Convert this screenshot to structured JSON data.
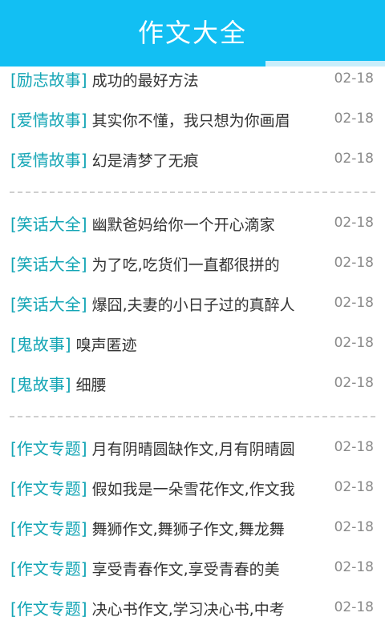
{
  "header": {
    "title": "作文大全",
    "background_color": "#12bff3",
    "progress": 0.69
  },
  "groups": [
    {
      "items": [
        {
          "category": "[励志故事]",
          "title": "成功的最好方法",
          "date": "02-18"
        },
        {
          "category": "[爱情故事]",
          "title": "其实你不懂，我只想为你画眉",
          "date": "02-18"
        },
        {
          "category": "[爱情故事]",
          "title": "幻是清梦了无痕",
          "date": "02-18"
        }
      ]
    },
    {
      "items": [
        {
          "category": "[笑话大全]",
          "title": "幽默爸妈给你一个开心滴家",
          "date": "02-18"
        },
        {
          "category": "[笑话大全]",
          "title": "为了吃,吃货们一直都很拼的",
          "date": "02-18"
        },
        {
          "category": "[笑话大全]",
          "title": "爆囧,夫妻的小日子过的真醉人",
          "date": "02-18"
        },
        {
          "category": "[鬼故事]",
          "title": "嗅声匿迹",
          "date": "02-18"
        },
        {
          "category": "[鬼故事]",
          "title": "细腰",
          "date": "02-18"
        }
      ]
    },
    {
      "items": [
        {
          "category": "[作文专题]",
          "title": "月有阴晴圆缺作文,月有阴晴圆",
          "date": "02-18"
        },
        {
          "category": "[作文专题]",
          "title": "假如我是一朵雪花作文,作文我",
          "date": "02-18"
        },
        {
          "category": "[作文专题]",
          "title": "舞狮作文,舞狮子作文,舞龙舞",
          "date": "02-18"
        },
        {
          "category": "[作文专题]",
          "title": "享受青春作文,享受青春的美",
          "date": "02-18"
        },
        {
          "category": "[作文专题]",
          "title": "决心书作文,学习决心书,中考",
          "date": "02-18"
        }
      ]
    }
  ],
  "colors": {
    "category": "#13a5b5",
    "title": "#333333",
    "date": "#8a8a8a",
    "divider": "#cfcfcf"
  }
}
